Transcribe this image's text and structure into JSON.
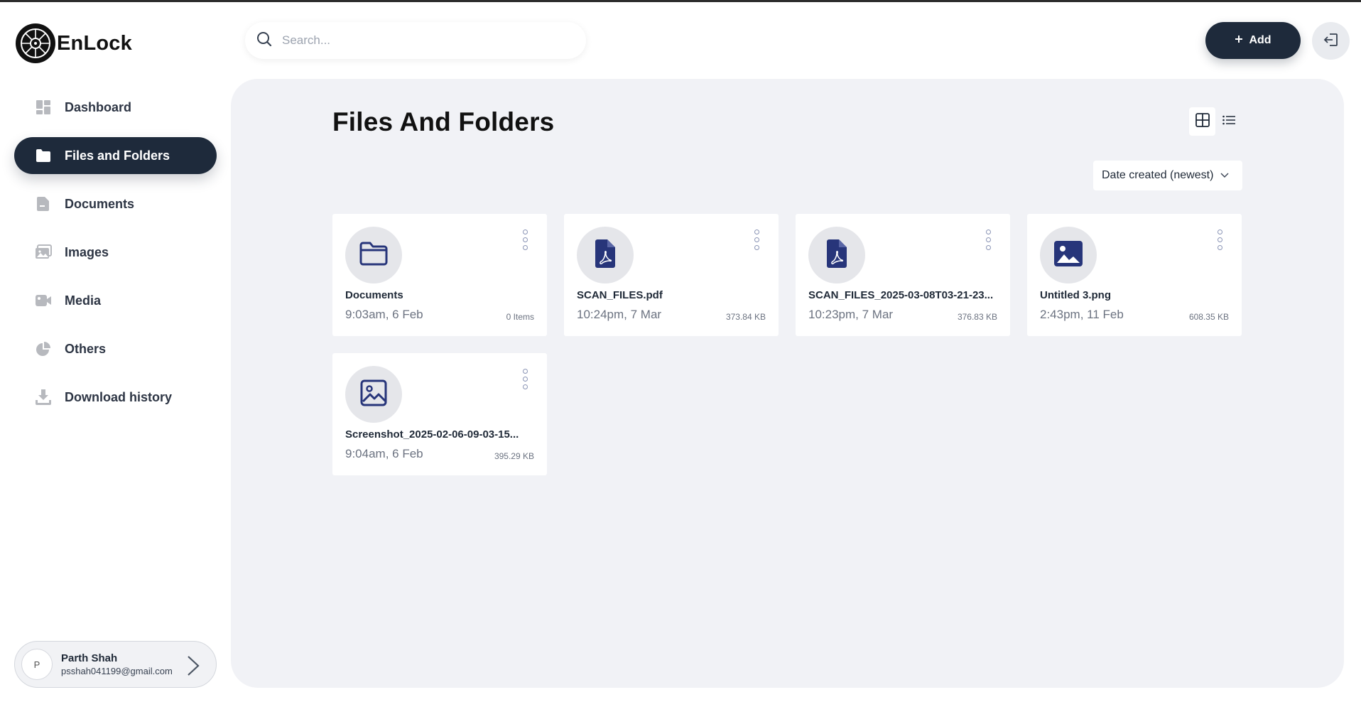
{
  "app": {
    "name": "EnLock"
  },
  "search": {
    "placeholder": "Search..."
  },
  "header": {
    "add_label": "Add"
  },
  "sidebar": {
    "items": [
      {
        "label": "Dashboard",
        "icon": "dashboard-icon",
        "active": false
      },
      {
        "label": "Files and Folders",
        "icon": "folder-icon",
        "active": true
      },
      {
        "label": "Documents",
        "icon": "document-icon",
        "active": false
      },
      {
        "label": "Images",
        "icon": "image-icon",
        "active": false
      },
      {
        "label": "Media",
        "icon": "video-icon",
        "active": false
      },
      {
        "label": "Others",
        "icon": "pie-chart-icon",
        "active": false
      },
      {
        "label": "Download history",
        "icon": "download-icon",
        "active": false
      }
    ]
  },
  "user": {
    "initial": "P",
    "name": "Parth Shah",
    "email": "psshah041199@gmail.com"
  },
  "main": {
    "title": "Files And Folders",
    "sort_label": "Date created (newest)",
    "view_mode": "grid",
    "items": [
      {
        "name": "Documents",
        "date": "9:03am, 6 Feb",
        "meta": "0 Items",
        "icon": "folder-icon"
      },
      {
        "name": "SCAN_FILES.pdf",
        "date": "10:24pm, 7 Mar",
        "meta": "373.84 KB",
        "icon": "pdf-icon"
      },
      {
        "name": "SCAN_FILES_2025-03-08T03-21-23...",
        "date": "10:23pm, 7 Mar",
        "meta": "376.83 KB",
        "icon": "pdf-icon"
      },
      {
        "name": "Untitled 3.png",
        "date": "2:43pm, 11 Feb",
        "meta": "608.35 KB",
        "icon": "image-filled-icon"
      },
      {
        "name": "Screenshot_2025-02-06-09-03-15...",
        "date": "9:04am, 6 Feb",
        "meta": "395.29 KB",
        "icon": "image-outline-icon"
      }
    ]
  },
  "colors": {
    "primary": "#1e2a3b",
    "panel_bg": "#f1f2f6",
    "file_icon": "#27357a"
  }
}
